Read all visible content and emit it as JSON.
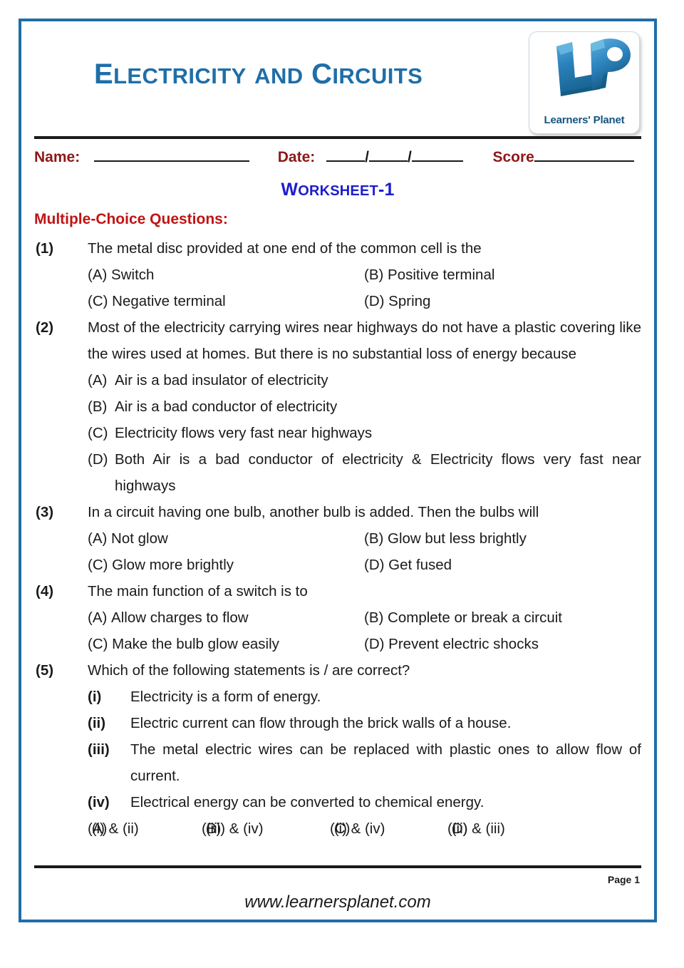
{
  "document": {
    "title_cap1": "E",
    "title_rest1": "LECTRICITY",
    "title_and": "AND",
    "title_cap2": "C",
    "title_rest2": "IRCUITS",
    "title_full": "ELECTRICITY AND CIRCUITS",
    "title_color": "#1f6ea8",
    "border_color": "#1f6ea8"
  },
  "logo": {
    "caption": "Learners' Planet",
    "letters": "LP",
    "color": "#2a7fb8"
  },
  "fields": {
    "name_label": "Name:",
    "date_label": "Date:",
    "score_label": "Score",
    "date_separator": "/",
    "name_value": "",
    "date_day_value": "",
    "date_month_value": "",
    "date_year_value": "",
    "score_value": ""
  },
  "worksheet": {
    "cap1": "W",
    "rest1": "ORKSHEET",
    "suffix": "-1",
    "full": "WORKSHEET-1",
    "color": "#1d1dcd"
  },
  "section": {
    "heading": "Multiple-Choice Questions:",
    "heading_color": "#c01414"
  },
  "questions": [
    {
      "number": "(1)",
      "stem": "The metal disc provided at one end of the common cell is the",
      "layout": "two-column",
      "options": [
        {
          "tag": "(A)",
          "text": "Switch"
        },
        {
          "tag": "(B)",
          "text": "Positive terminal"
        },
        {
          "tag": "(C)",
          "text": "Negative terminal"
        },
        {
          "tag": "(D)",
          "text": "Spring"
        }
      ]
    },
    {
      "number": "(2)",
      "stem": "Most of the electricity carrying wires near highways do not have a plastic covering like the wires used at homes. But there is no substantial loss of energy because",
      "layout": "stacked",
      "options": [
        {
          "tag": "(A)",
          "text": "Air is a bad insulator of electricity"
        },
        {
          "tag": "(B)",
          "text": "Air is a bad conductor of electricity"
        },
        {
          "tag": "(C)",
          "text": "Electricity flows very fast near highways"
        },
        {
          "tag": "(D)",
          "text": "Both Air is a bad conductor of electricity & Electricity flows very fast near highways"
        }
      ]
    },
    {
      "number": "(3)",
      "stem": "In a circuit having one bulb, another bulb is added. Then the bulbs will",
      "layout": "two-column",
      "options": [
        {
          "tag": "(A)",
          "text": "Not glow"
        },
        {
          "tag": "(B)",
          "text": "Glow but less brightly"
        },
        {
          "tag": "(C)",
          "text": "Glow more brightly"
        },
        {
          "tag": "(D)",
          "text": "Get fused"
        }
      ]
    },
    {
      "number": "(4)",
      "stem": "The main function of a switch is to",
      "layout": "two-column",
      "options": [
        {
          "tag": "(A)",
          "text": "Allow charges to flow"
        },
        {
          "tag": "(B)",
          "text": "Complete or break a circuit"
        },
        {
          "tag": "(C)",
          "text": "Make the bulb glow easily"
        },
        {
          "tag": "(D)",
          "text": "Prevent electric shocks"
        }
      ]
    },
    {
      "number": "(5)",
      "stem": "Which of the following statements is / are correct?",
      "layout": "statements",
      "statements": [
        {
          "rn": "(i)",
          "text": "Electricity  is a form of energy."
        },
        {
          "rn": "(ii)",
          "text": "Electric current can flow through the brick walls of a house."
        },
        {
          "rn": "(iii)",
          "text": "The metal electric wires can be replaced with plastic ones to allow flow of current."
        },
        {
          "rn": "(iv)",
          "text": "Electrical energy can be converted to chemical energy."
        }
      ],
      "options": [
        {
          "tag": "(A)",
          "text": "(i) & (ii)"
        },
        {
          "tag": "(B)",
          "text": "(iii) & (iv)"
        },
        {
          "tag": "(C)",
          "text": "(i) & (iv)"
        },
        {
          "tag": "(D)",
          "text": "(ii) & (iii)"
        }
      ]
    }
  ],
  "footer": {
    "page_label": "Page 1",
    "website": "www.learnersplanet.com"
  }
}
